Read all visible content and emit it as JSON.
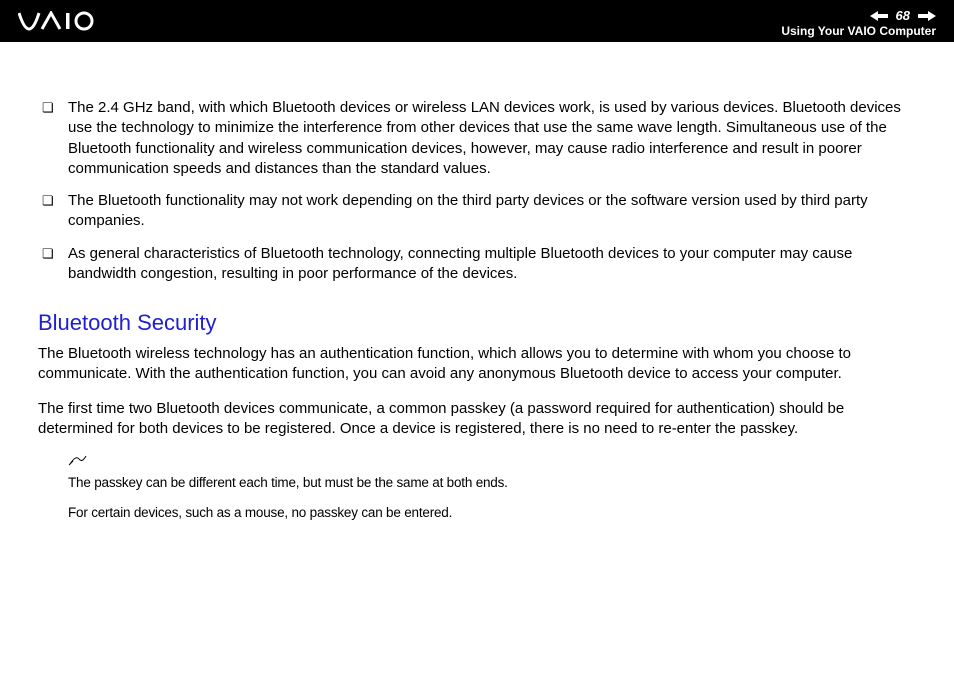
{
  "header": {
    "page_number": "68",
    "section": "Using Your VAIO Computer"
  },
  "bullets": [
    "The 2.4 GHz band, with which Bluetooth devices or wireless LAN devices work, is used by various devices. Bluetooth devices use the technology to minimize the interference from other devices that use the same wave length. Simultaneous use of the Bluetooth functionality and wireless communication devices, however, may cause radio interference and result in poorer communication speeds and distances than the standard values.",
    "The Bluetooth functionality may not work depending on the third party devices or the software version used by third party companies.",
    "As general characteristics of Bluetooth technology, connecting multiple Bluetooth devices to your computer may cause bandwidth congestion, resulting in poor performance of the devices."
  ],
  "heading": "Bluetooth Security",
  "paragraphs": [
    "The Bluetooth wireless technology has an authentication function, which allows you to determine with whom you choose to communicate. With the authentication function, you can avoid any anonymous Bluetooth device to access your computer.",
    "The first time two Bluetooth devices communicate, a common passkey (a password required for authentication) should be determined for both devices to be registered. Once a device is registered, there is no need to re-enter the passkey."
  ],
  "notes": [
    "The passkey can be different each time, but must be the same at both ends.",
    "For certain devices, such as a mouse, no passkey can be entered."
  ]
}
